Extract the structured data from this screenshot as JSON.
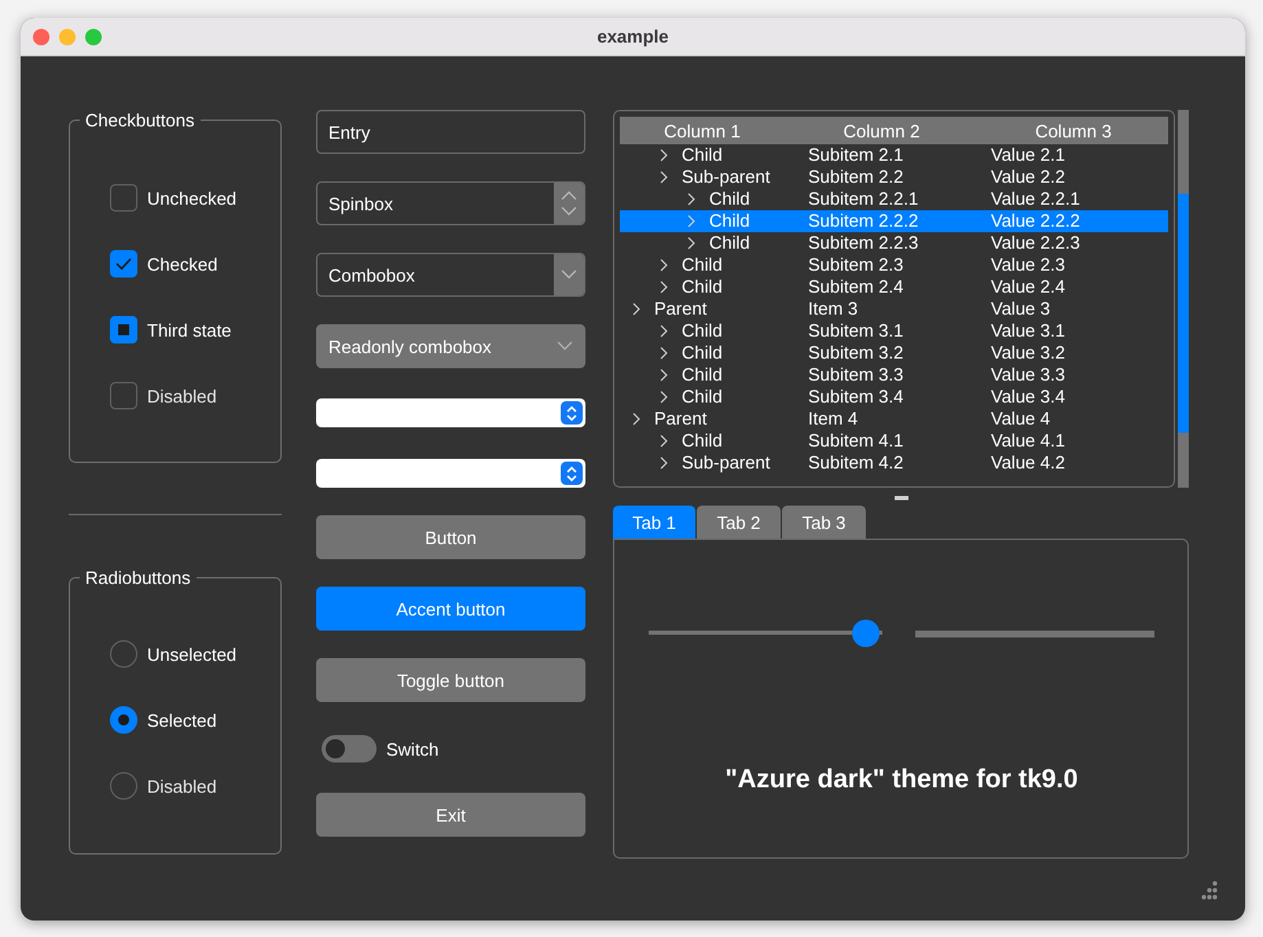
{
  "window": {
    "title": "example"
  },
  "checkbuttons": {
    "title": "Checkbuttons",
    "items": [
      {
        "label": "Unchecked",
        "checked": false,
        "indeterminate": false,
        "disabled": false
      },
      {
        "label": "Checked",
        "checked": true,
        "indeterminate": false,
        "disabled": false
      },
      {
        "label": "Third state",
        "checked": true,
        "indeterminate": true,
        "disabled": false
      },
      {
        "label": "Disabled",
        "checked": false,
        "indeterminate": false,
        "disabled": true
      }
    ]
  },
  "radiobuttons": {
    "title": "Radiobuttons",
    "items": [
      {
        "label": "Unselected",
        "selected": false,
        "disabled": false
      },
      {
        "label": "Selected",
        "selected": true,
        "disabled": false
      },
      {
        "label": "Disabled",
        "selected": false,
        "disabled": true
      }
    ]
  },
  "entry": {
    "value": "Entry"
  },
  "spinbox": {
    "value": "Spinbox"
  },
  "combobox": {
    "value": "Combobox"
  },
  "readonly_combobox": {
    "value": "Readonly combobox"
  },
  "buttons": [
    {
      "label": "Button",
      "kind": "normal"
    },
    {
      "label": "Accent button",
      "kind": "accent"
    },
    {
      "label": "Toggle button",
      "kind": "normal"
    }
  ],
  "switch": {
    "label": "Switch",
    "on": false
  },
  "exit_button": {
    "label": "Exit"
  },
  "tree": {
    "columns": [
      "Column 1",
      "Column 2",
      "Column 3"
    ],
    "rows": [
      {
        "children": [
          {
            "cells": [
              "Child",
              "Subitem 2.1",
              "Value 2.1"
            ],
            "selected": false
          },
          {
            "cells": [
              "Sub-parent",
              "Subitem 2.2",
              "Value 2.2"
            ],
            "selected": false,
            "children": [
              {
                "cells": [
                  "Child",
                  "Subitem 2.2.1",
                  "Value 2.2.1"
                ],
                "selected": false
              },
              {
                "cells": [
                  "Child",
                  "Subitem 2.2.2",
                  "Value 2.2.2"
                ],
                "selected": true
              },
              {
                "cells": [
                  "Child",
                  "Subitem 2.2.3",
                  "Value 2.2.3"
                ],
                "selected": false
              }
            ]
          },
          {
            "cells": [
              "Child",
              "Subitem 2.3",
              "Value 2.3"
            ],
            "selected": false
          },
          {
            "cells": [
              "Child",
              "Subitem 2.4",
              "Value 2.4"
            ],
            "selected": false
          }
        ]
      },
      {
        "cells": [
          "Parent",
          "Item 3",
          "Value 3"
        ],
        "selected": false,
        "children": [
          {
            "cells": [
              "Child",
              "Subitem 3.1",
              "Value 3.1"
            ],
            "selected": false
          },
          {
            "cells": [
              "Child",
              "Subitem 3.2",
              "Value 3.2"
            ],
            "selected": false
          },
          {
            "cells": [
              "Child",
              "Subitem 3.3",
              "Value 3.3"
            ],
            "selected": false
          },
          {
            "cells": [
              "Child",
              "Subitem 3.4",
              "Value 3.4"
            ],
            "selected": false
          }
        ]
      },
      {
        "cells": [
          "Parent",
          "Item 4",
          "Value 4"
        ],
        "selected": false,
        "children": [
          {
            "cells": [
              "Child",
              "Subitem 4.1",
              "Value 4.1"
            ],
            "selected": false
          },
          {
            "cells": [
              "Sub-parent",
              "Subitem 4.2",
              "Value 4.2"
            ],
            "selected": false
          }
        ]
      }
    ]
  },
  "tabs": [
    {
      "label": "Tab 1",
      "selected": true
    },
    {
      "label": "Tab 2",
      "selected": false
    },
    {
      "label": "Tab 3",
      "selected": false
    }
  ],
  "scale": {
    "level": 0.93
  },
  "progressbar": {
    "level": 0
  },
  "theme_label": "\"Azure dark\" theme for tk9.0"
}
